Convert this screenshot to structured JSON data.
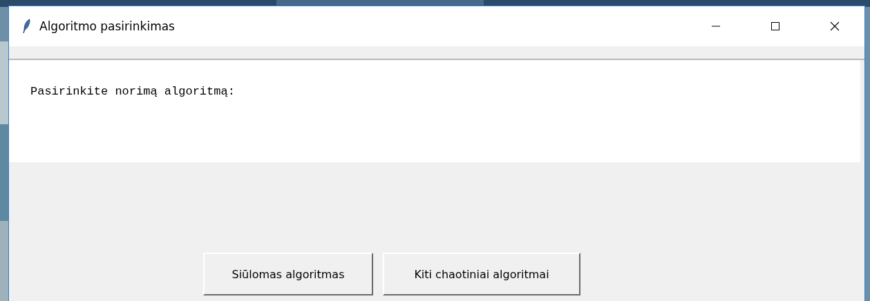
{
  "window": {
    "title": "Algoritmo pasirinkimas"
  },
  "prompt": "Pasirinkite norimą algoritmą:",
  "buttons": [
    {
      "label": "Siūlomas algoritmas"
    },
    {
      "label": "Kiti chaotiniai algoritmai"
    }
  ]
}
